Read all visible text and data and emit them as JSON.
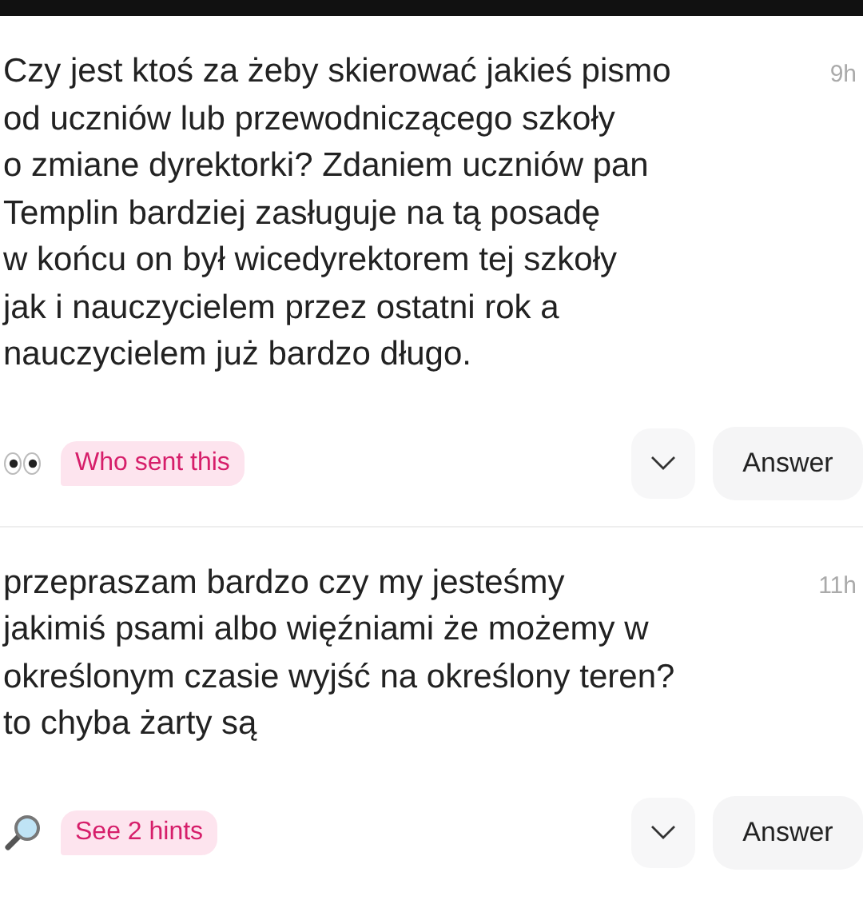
{
  "questions": [
    {
      "text": "Czy jest ktoś za żeby skierować jakieś pismo\nod uczniów lub przewodniczącego szkoły\no zmiane dyrektorki? Zdaniem uczniów pan\nTemplin bardziej zasługuje na tą posadę\nw końcu on był wicedyrektorem tej szkoły\njak i nauczycielem przez ostatni rok a\nnauczycielem już bardzo długo.",
      "time": "9h",
      "hint": {
        "kind": "eyes",
        "label": "Who sent this"
      },
      "answer": "Answer"
    },
    {
      "text": "przepraszam bardzo czy my jesteśmy\njakimiś psami albo więźniami że możemy w\nokreślonym czasie wyjść na określony teren?\nto chyba żarty są",
      "time": "11h",
      "hint": {
        "kind": "magnifier",
        "label": "See 2 hints"
      },
      "answer": "Answer"
    }
  ]
}
